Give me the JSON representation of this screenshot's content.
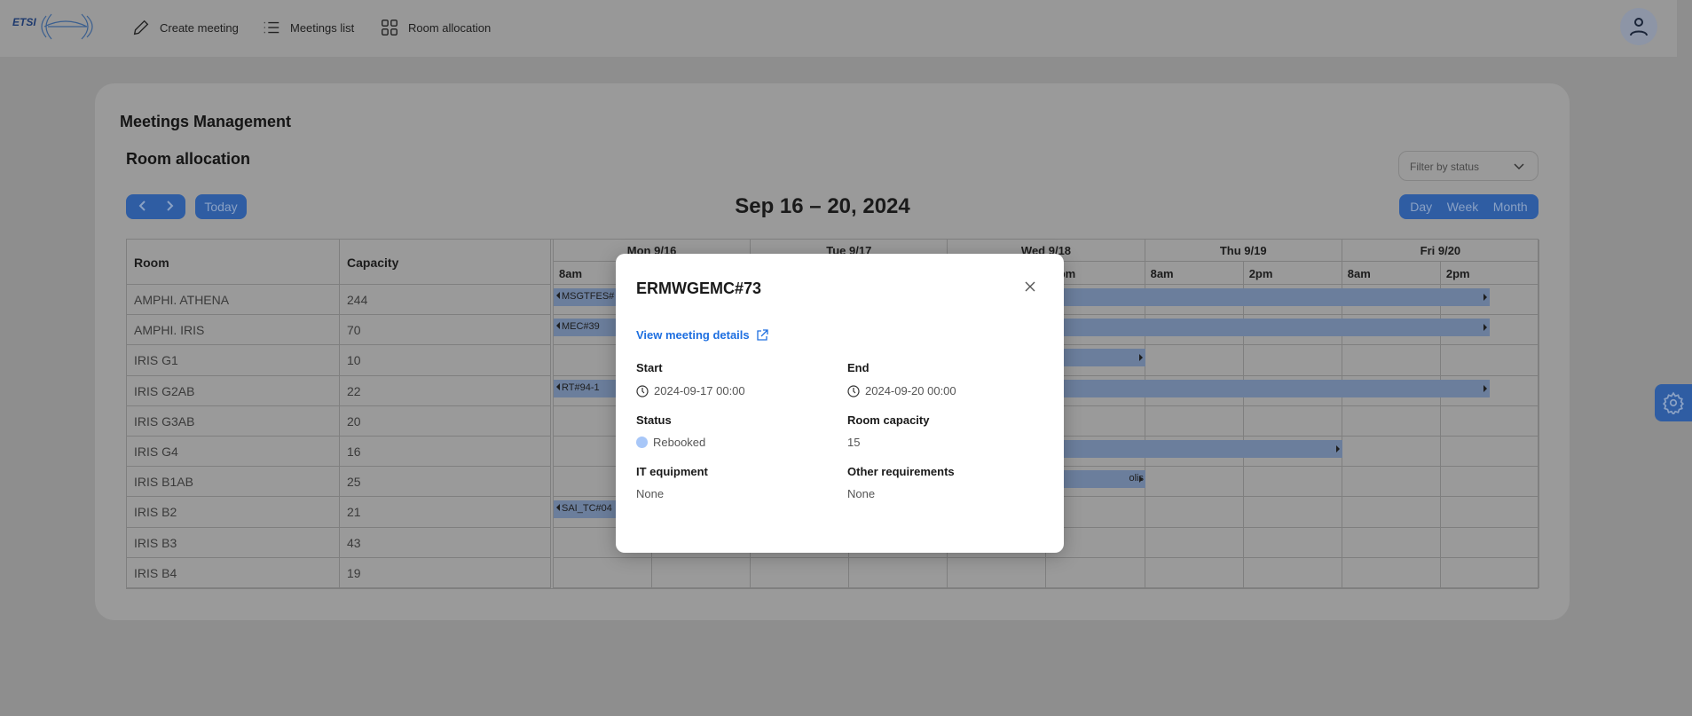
{
  "header": {
    "logo_text": "ETSI",
    "nav": [
      {
        "label": "Create meeting",
        "icon": "pencil-icon"
      },
      {
        "label": "Meetings list",
        "icon": "list-icon"
      },
      {
        "label": "Room allocation",
        "icon": "grid-icon"
      }
    ],
    "user_icon": "user-icon"
  },
  "page": {
    "title": "Meetings Management",
    "subtitle": "Room allocation",
    "filter_placeholder": "Filter by status",
    "today_label": "Today",
    "range_title": "Sep 16 – 20, 2024",
    "views": [
      "Day",
      "Week",
      "Month"
    ]
  },
  "table": {
    "columns": [
      "Room",
      "Capacity"
    ],
    "rows": [
      {
        "room": "AMPHI. ATHENA",
        "capacity": "244"
      },
      {
        "room": "AMPHI. IRIS",
        "capacity": "70"
      },
      {
        "room": "IRIS G1",
        "capacity": "10"
      },
      {
        "room": "IRIS G2AB",
        "capacity": "22"
      },
      {
        "room": "IRIS G3AB",
        "capacity": "20"
      },
      {
        "room": "IRIS G4",
        "capacity": "16"
      },
      {
        "room": "IRIS B1AB",
        "capacity": "25"
      },
      {
        "room": "IRIS B2",
        "capacity": "21"
      },
      {
        "room": "IRIS B3",
        "capacity": "43"
      },
      {
        "room": "IRIS B4",
        "capacity": "19"
      }
    ]
  },
  "calendar": {
    "days": [
      "Mon 9/16",
      "Tue 9/17",
      "Wed 9/18",
      "Thu 9/19",
      "Fri 9/20"
    ],
    "slots": [
      "8am",
      "2pm"
    ],
    "events": [
      {
        "label": "MSGTFES#"
      },
      {
        "label": "MEC#39"
      },
      {
        "label": ""
      },
      {
        "label": "RT#94-1"
      },
      {
        "label": ""
      },
      {
        "label": "olis"
      },
      {
        "label": "SAI_TC#04"
      }
    ]
  },
  "modal": {
    "title": "ERMWGEMC#73",
    "link": "View meeting details",
    "start_label": "Start",
    "start": "2024-09-17 00:00",
    "end_label": "End",
    "end": "2024-09-20 00:00",
    "status_label": "Status",
    "status": "Rebooked",
    "status_color": "#a8c7f8",
    "capacity_label": "Room capacity",
    "capacity": "15",
    "it_label": "IT equipment",
    "it": "None",
    "other_label": "Other requirements",
    "other": "None"
  },
  "colors": {
    "accent": "#2f5da3",
    "link": "#1e6fe0",
    "event": "#6b7e9c"
  }
}
